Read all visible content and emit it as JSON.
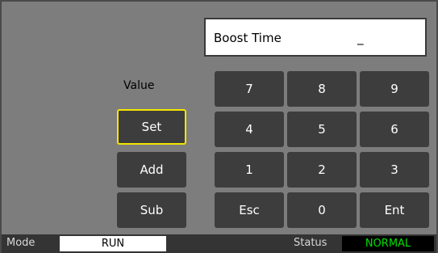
{
  "display": {
    "label": "Boost Time",
    "cursor": "_"
  },
  "value_label": "Value",
  "side_buttons": {
    "set": "Set",
    "add": "Add",
    "sub": "Sub"
  },
  "keypad": {
    "k7": "7",
    "k8": "8",
    "k9": "9",
    "k4": "4",
    "k5": "5",
    "k6": "6",
    "k1": "1",
    "k2": "2",
    "k3": "3",
    "esc": "Esc",
    "k0": "0",
    "ent": "Ent"
  },
  "statusbar": {
    "mode_label": "Mode",
    "mode_value": "RUN",
    "status_label": "Status",
    "status_value": "NORMAL",
    "status_color": "#00e000"
  }
}
